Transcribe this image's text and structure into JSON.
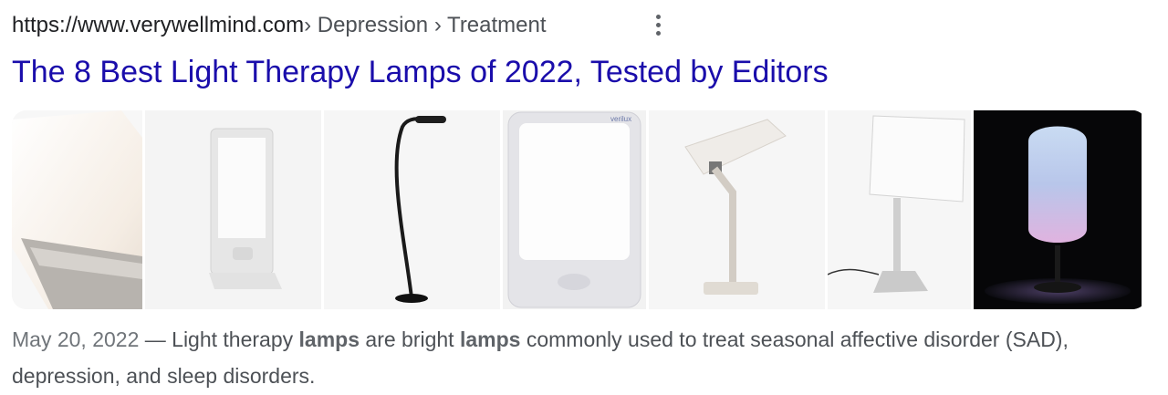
{
  "result": {
    "site_url": "https://www.verywellmind.com",
    "breadcrumb": " › Depression › Treatment",
    "title": "The 8 Best Light Therapy Lamps of 2022, Tested by Editors",
    "images": [
      {
        "alt": "light therapy lamp angled"
      },
      {
        "alt": "slim white light panel"
      },
      {
        "alt": "floor lamp"
      },
      {
        "alt": "Verilux light panel",
        "brand": "verilux"
      },
      {
        "alt": "desk light therapy lamp"
      },
      {
        "alt": "light panel on stand"
      },
      {
        "alt": "oval lamp with gradient glow"
      }
    ],
    "snippet": {
      "date": "May 20, 2022",
      "dash": " — ",
      "parts": [
        "Light therapy ",
        "lamps",
        " are bright ",
        "lamps",
        " commonly used to treat seasonal affective disorder (SAD), depression, and sleep disorders."
      ]
    }
  },
  "colors": {
    "title_link": "#1a0dab",
    "url": "#202124",
    "snippet": "#4d5156",
    "date": "#70757a"
  },
  "icons": {
    "menu": "more-vert-icon"
  }
}
